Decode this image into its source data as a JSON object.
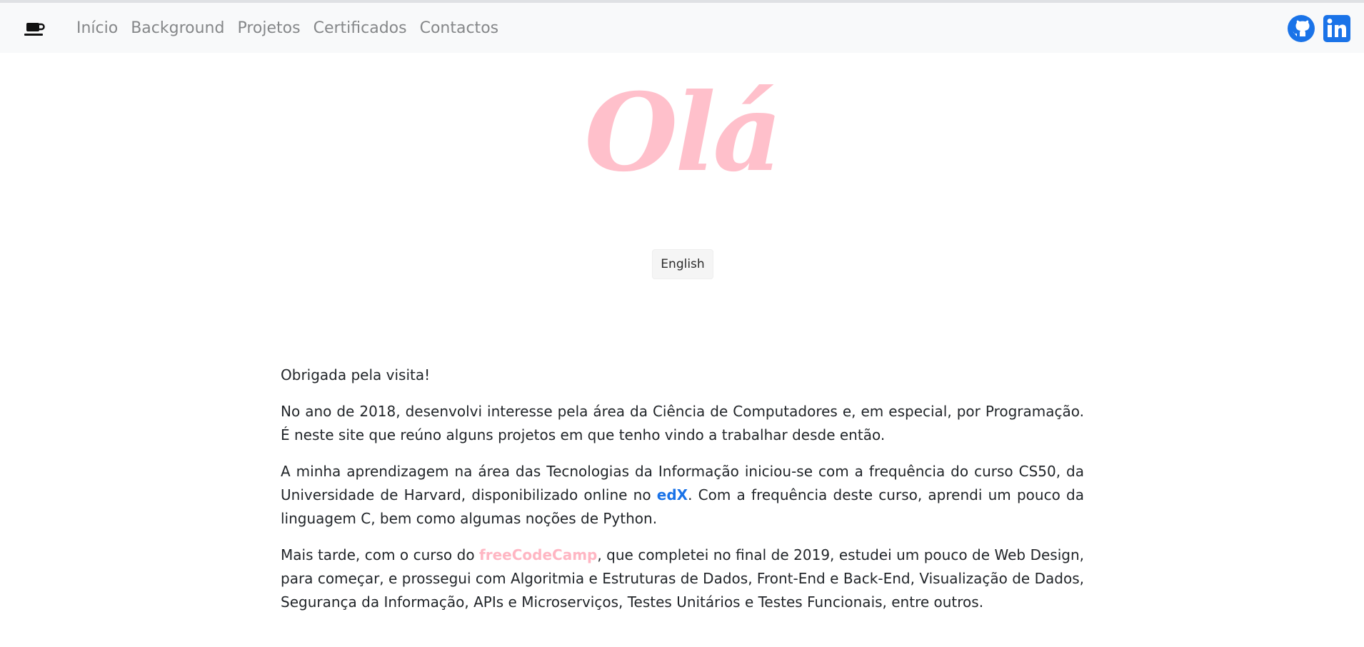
{
  "nav": {
    "items": [
      {
        "label": "Início"
      },
      {
        "label": "Background"
      },
      {
        "label": "Projetos"
      },
      {
        "label": "Certificados"
      },
      {
        "label": "Contactos"
      }
    ],
    "brand_icon": "coffee-cup-icon",
    "social": {
      "github_icon": "github-icon",
      "linkedin_icon": "linkedin-icon"
    }
  },
  "hero": {
    "title": "Olá",
    "color": "#ffc0cb"
  },
  "language_button": {
    "label": "English"
  },
  "content": {
    "p1": "Obrigada pela visita!",
    "p2": "No ano de 2018, desenvolvi interesse pela área da Ciência de Computadores e, em especial, por Programação. É neste site que reúno alguns projetos em que tenho vindo a trabalhar desde então.",
    "p3_before": "A minha aprendizagem na área das Tecnologias da Informação iniciou-se com a frequência do curso CS50, da Universidade de Harvard, disponibilizado online no ",
    "p3_link": "edX",
    "p3_after": ". Com a frequência deste curso, aprendi um pouco da linguagem C, bem como algumas noções de Python.",
    "p4_before": "Mais tarde, com o curso do ",
    "p4_link": "freeCodeCamp",
    "p4_after": ", que completei no final de 2019, estudei um pouco de Web Design, para começar, e prossegui com Algoritmia e Estruturas de Dados, Front-End e Back-End, Visualização de Dados, Segurança da Informação, APIs e Microserviços, Testes Unitários e Testes Funcionais, entre outros."
  },
  "colors": {
    "navbar_bg": "#f8f9fa",
    "edx_link": "#1a73e8",
    "fcc_link": "#ffb6c3",
    "github": "#1a73e8",
    "linkedin": "#1a73e8"
  }
}
